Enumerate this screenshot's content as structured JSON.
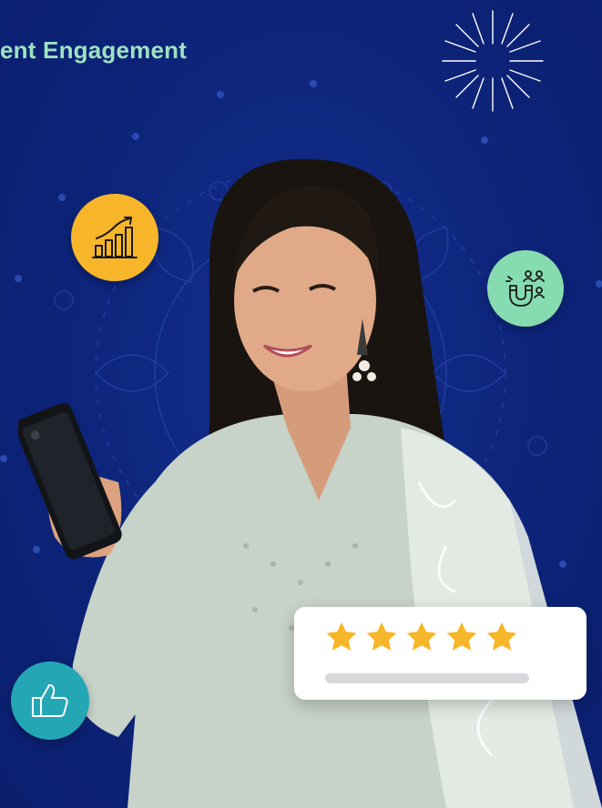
{
  "headline": {
    "text": "ent Engagement"
  },
  "colors": {
    "background": "#0c2378",
    "headline": "#9ee2c2",
    "growth_badge": "#f7b629",
    "magnet_badge": "#86dcb0",
    "like_badge": "#25a6b4",
    "star": "#f7b629",
    "card": "#ffffff"
  },
  "icons": {
    "growth": "growth-chart-icon",
    "magnet": "magnet-users-icon",
    "like": "thumbs-up-icon",
    "decoration": "starburst-icon"
  },
  "rating": {
    "stars": 5,
    "max": 5
  }
}
